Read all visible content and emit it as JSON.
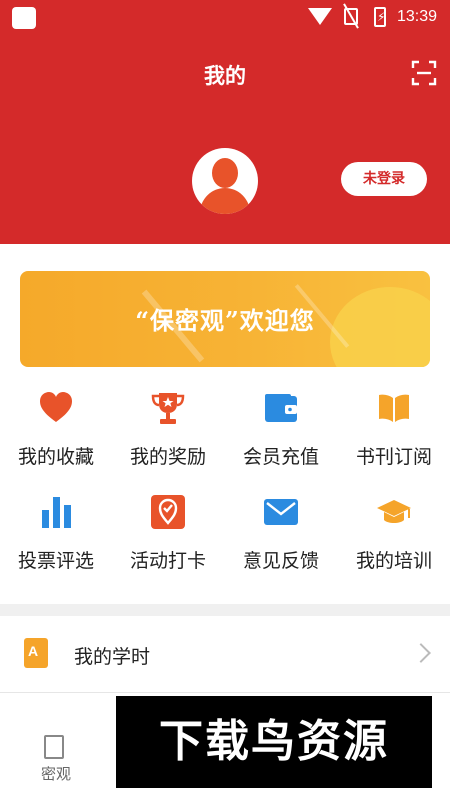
{
  "status_bar": {
    "time": "13:39"
  },
  "header": {
    "title": "我的",
    "login_label": "未登录"
  },
  "banner": {
    "text": "“保密观”欢迎您"
  },
  "grid": [
    {
      "label": "我的收藏",
      "icon": "heart-icon",
      "color": "#e8532a"
    },
    {
      "label": "我的奖励",
      "icon": "trophy-icon",
      "color": "#e8532a"
    },
    {
      "label": "会员充值",
      "icon": "wallet-icon",
      "color": "#2b8be0"
    },
    {
      "label": "书刊订阅",
      "icon": "book-icon",
      "color": "#f5a42a"
    },
    {
      "label": "投票评选",
      "icon": "bar-chart-icon",
      "color": "#2b8be0"
    },
    {
      "label": "活动打卡",
      "icon": "checkin-icon",
      "color": "#e8532a"
    },
    {
      "label": "意见反馈",
      "icon": "mail-icon",
      "color": "#2b8be0"
    },
    {
      "label": "我的培训",
      "icon": "graduation-cap-icon",
      "color": "#f5a42a"
    }
  ],
  "study_row": {
    "label": "我的学时",
    "icon_text": "A"
  },
  "bottom_nav": {
    "tab_label": "密观"
  },
  "watermark": {
    "text": "下载鸟资源"
  },
  "colors": {
    "brand_red": "#d42a2a",
    "accent_orange": "#f5a42a",
    "accent_blue": "#2b8be0"
  }
}
